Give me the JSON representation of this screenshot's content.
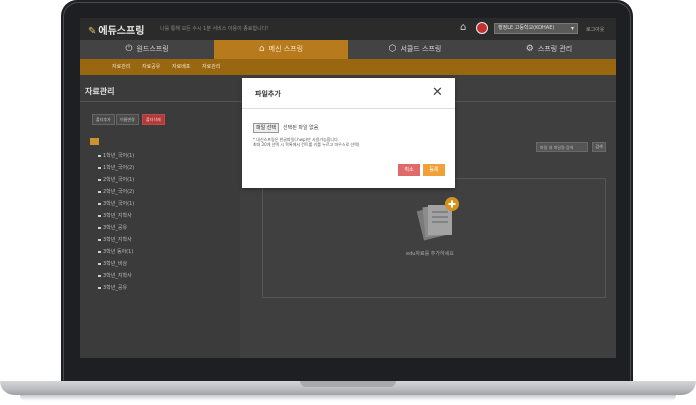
{
  "app": {
    "logo_text": "에듀스프링",
    "tagline": "나를 통해 모든 수시 1분 서비스 이용이 종료합니다!",
    "school_select_value": "행정LE 고등학교(KOHAE)",
    "logout_label": "로그아웃"
  },
  "nav": {
    "items": [
      {
        "label": "원드스프링",
        "icon": "power-icon"
      },
      {
        "label": "메신 스프링",
        "icon": "home-icon"
      },
      {
        "label": "서클드 스프링",
        "icon": "cube-icon"
      },
      {
        "label": "스프링 관리",
        "icon": "gear-icon"
      }
    ],
    "active_index": 1
  },
  "subnav": {
    "items": [
      "자료관리",
      "자료공유",
      "자료배포",
      "자료관리"
    ]
  },
  "left_panel": {
    "title": "자료관리",
    "buttons": [
      "폴더추가",
      "이름변경",
      "폴더삭제"
    ],
    "tree": [
      "1학년_국어(1)",
      "1학년_국어(2)",
      "2학년_국어(1)",
      "2학년_국어(2)",
      "3학년_국어(1)",
      "3학년_지학사",
      "3학년_공유",
      "3학년_지학사",
      "3학년 동아(1)",
      "3학년_비상",
      "3학년_지학사",
      "3학년_공유"
    ]
  },
  "main": {
    "search_placeholder": "파일 내 파일명 검색",
    "search_button": "검색",
    "empty_text": "edu자료를 추가하세요"
  },
  "modal": {
    "title": "파일추가",
    "file_button": "파일 선택",
    "file_status": "선택된 파일 없음",
    "note_line1": "* 내신스프링은 한글파일(.hwp)만 사용가능합니다.",
    "note_line2": "최대 20개 선택 시 목록에서 컨트롤 키를 누르고 마우스로 선택)",
    "cancel_label": "취소",
    "register_label": "등록"
  },
  "colors": {
    "accent": "#b77a1d",
    "cancel": "#e06a6a",
    "register": "#f0a23a"
  }
}
